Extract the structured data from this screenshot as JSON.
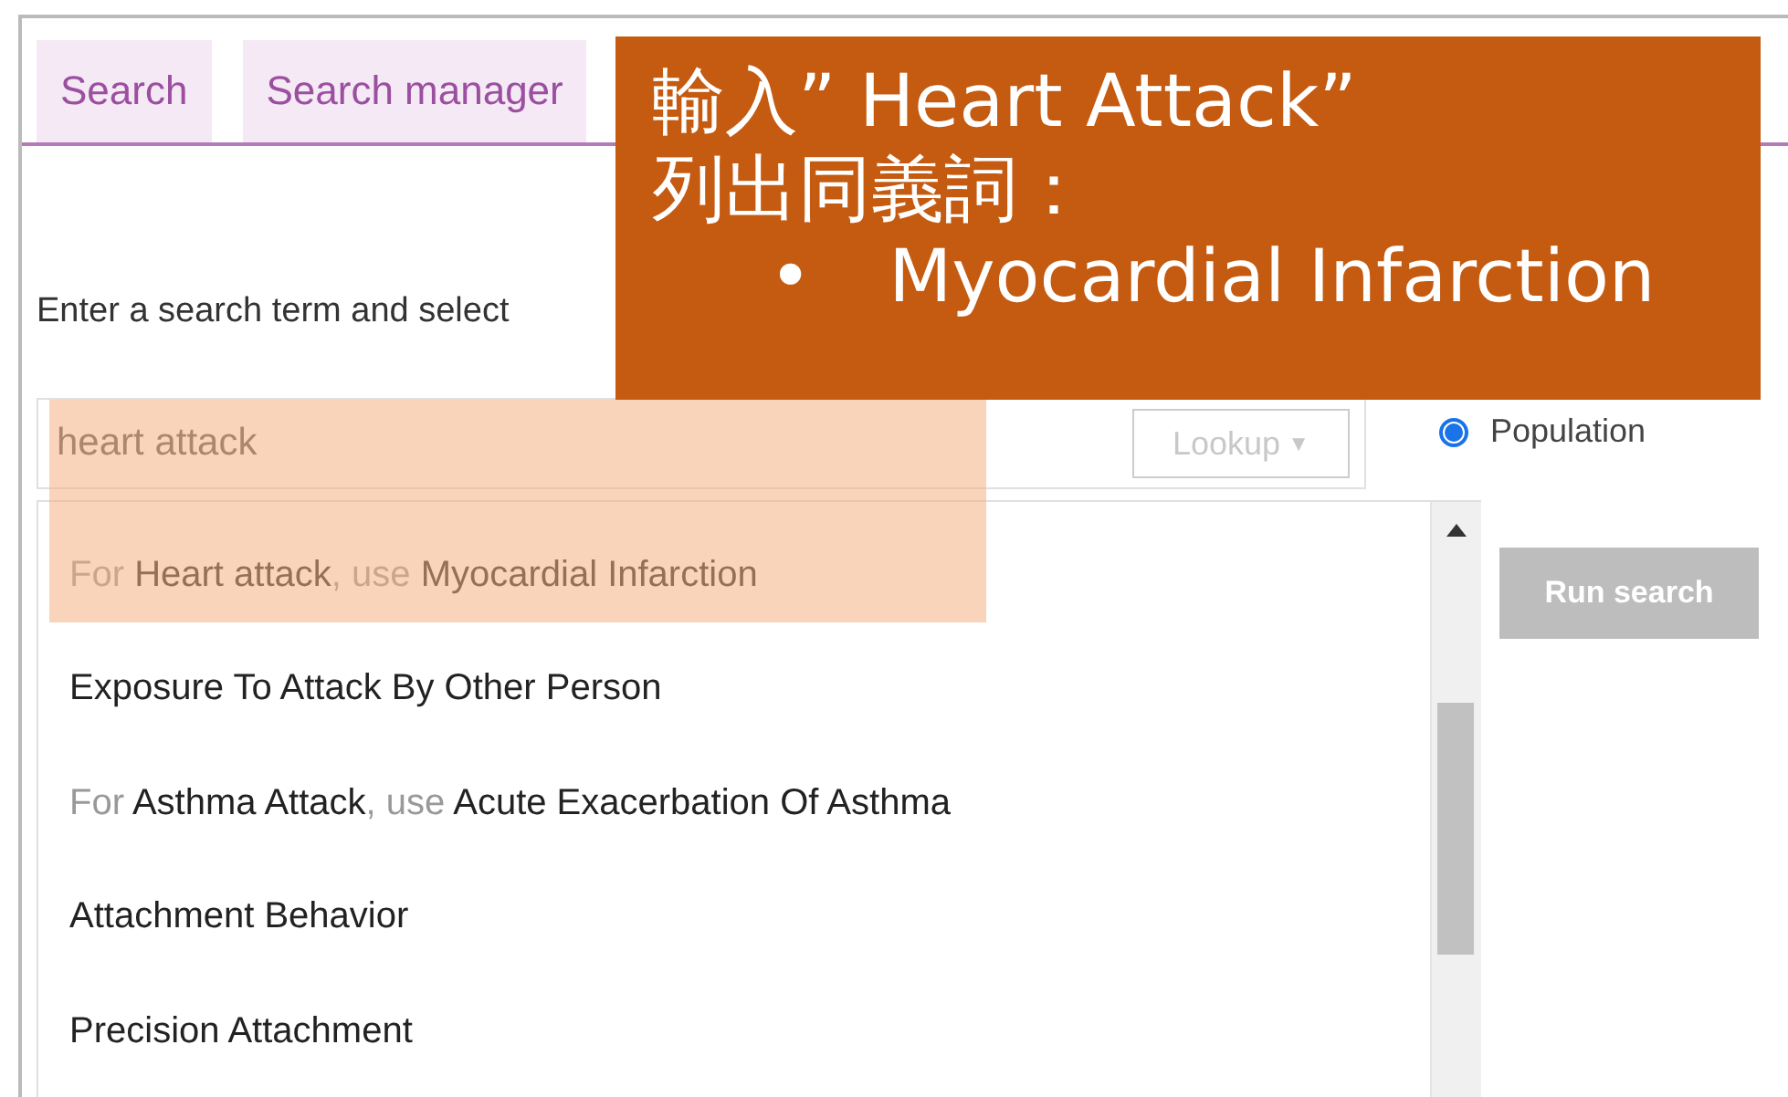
{
  "tabs": [
    {
      "label": "Search",
      "selected": false
    },
    {
      "label": "Search manager",
      "selected": false
    }
  ],
  "instruction": "Enter a search term and select",
  "search": {
    "value": "heart attack",
    "lookup": {
      "label": "Lookup",
      "caret": "▼",
      "disabled": true
    }
  },
  "suggestions": [
    {
      "kind": "synonym",
      "prefix": "For",
      "term": "Heart attack",
      "joiner": ", use",
      "preferred": "Myocardial Infarction"
    },
    {
      "kind": "term",
      "label": "Exposure To Attack By Other Person"
    },
    {
      "kind": "synonym",
      "prefix": "For",
      "term": "Asthma Attack",
      "joiner": ", use",
      "preferred": "Acute Exacerbation Of Asthma"
    },
    {
      "kind": "term",
      "label": "Attachment Behavior"
    },
    {
      "kind": "term",
      "label": "Precision Attachment"
    }
  ],
  "options": [
    {
      "label": "Population",
      "selected": true
    }
  ],
  "run_search": {
    "label": "Run search",
    "disabled": true
  },
  "callout": {
    "lines": [
      "輸入” Heart Attack”",
      "列出同義詞："
    ],
    "bullets": [
      {
        "marker": "•",
        "text": "Myocardial Infarction"
      }
    ]
  }
}
